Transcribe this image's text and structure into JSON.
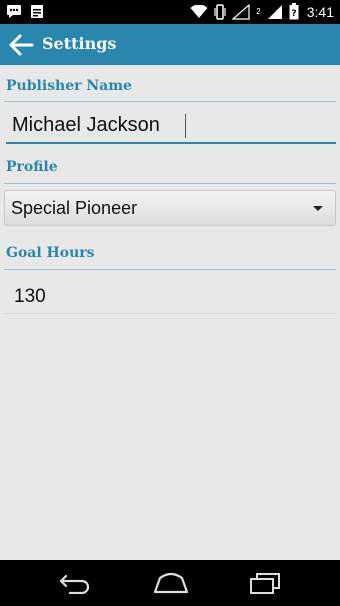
{
  "status_bar": {
    "time": "3:41",
    "network_badge": "2",
    "notification_icons": [
      "chat-icon",
      "calendar-icon"
    ],
    "system_icons": [
      "wifi-icon",
      "vibrate-icon",
      "no-signal-icon",
      "signal-icon",
      "battery-icon"
    ]
  },
  "action_bar": {
    "title": "Settings",
    "back_icon": "back-arrow-icon"
  },
  "publisher": {
    "label": "Publisher Name",
    "value": "Michael Jackson"
  },
  "profile": {
    "label": "Profile",
    "selected": "Special Pioneer"
  },
  "goal": {
    "label": "Goal Hours",
    "value": "130"
  },
  "nav_bar": {
    "buttons": [
      "back-icon",
      "home-icon",
      "recent-apps-icon"
    ]
  },
  "colors": {
    "accent": "#2a86ad",
    "background": "#e8e8e8"
  }
}
